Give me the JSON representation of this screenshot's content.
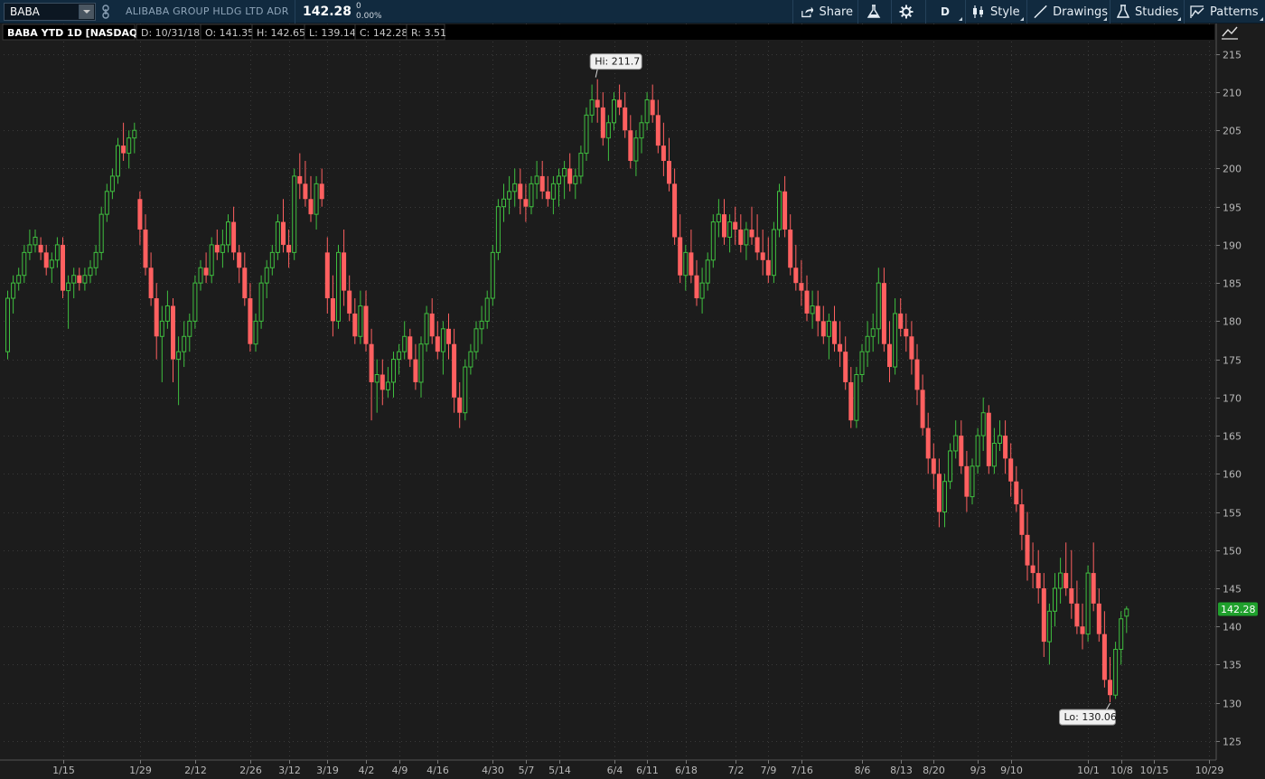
{
  "toolbar": {
    "symbol": "BABA",
    "company": "ALIBABA GROUP HLDG LTD ADR",
    "last": "142.28",
    "net_change": "0",
    "pct_change": "0.00%",
    "share_label": "Share",
    "aggregation_label": "D",
    "style_label": "Style",
    "drawings_label": "Drawings",
    "studies_label": "Studies",
    "patterns_label": "Patterns"
  },
  "chart_data": {
    "type": "candlestick",
    "title": "BABA YTD 1D [NASDAQ]",
    "header": {
      "date": "D: 10/31/18",
      "open": "O: 141.35",
      "high": "H: 142.65",
      "low": "L: 139.14",
      "close": "C: 142.28",
      "range": "R: 3.51"
    },
    "ylim": [
      122.5,
      219
    ],
    "y_ticks": [
      125,
      130,
      135,
      140,
      145,
      150,
      155,
      160,
      165,
      170,
      175,
      180,
      185,
      190,
      195,
      200,
      205,
      210,
      215
    ],
    "x_ticks": [
      "1/15",
      "1/29",
      "2/12",
      "2/26",
      "3/12",
      "3/19",
      "4/2",
      "4/9",
      "4/16",
      "4/30",
      "5/7",
      "5/14",
      "6/4",
      "6/11",
      "6/18",
      "7/2",
      "7/9",
      "7/16",
      "8/6",
      "8/13",
      "8/20",
      "9/3",
      "9/10",
      "10/1",
      "10/8",
      "10/15",
      "10/29"
    ],
    "x_tick_bar_index": [
      10,
      24,
      34,
      44,
      51,
      58,
      65,
      71,
      78,
      88,
      94,
      100,
      110,
      116,
      123,
      132,
      138,
      144,
      155,
      162,
      168,
      176,
      182,
      196,
      202,
      208,
      218
    ],
    "current_price_label": "142.28",
    "high_label": "Hi: 211.7",
    "low_label": "Lo: 130.06",
    "up_color": "#3fbf3f",
    "down_color": "#ff6060",
    "price_tag_color": "#1fa02c",
    "grid": true,
    "candles": [
      [
        176,
        184,
        175,
        183
      ],
      [
        183,
        186,
        181,
        185
      ],
      [
        185,
        187,
        184,
        186
      ],
      [
        186,
        190,
        185,
        189
      ],
      [
        189,
        192,
        188,
        190
      ],
      [
        190,
        192,
        189,
        191
      ],
      [
        190,
        191,
        188,
        189
      ],
      [
        189,
        190,
        186,
        187
      ],
      [
        187,
        189,
        185,
        188
      ],
      [
        188,
        191,
        187,
        190
      ],
      [
        190,
        191,
        183,
        184
      ],
      [
        184,
        186,
        179,
        185
      ],
      [
        185,
        187,
        183,
        186
      ],
      [
        186,
        187,
        184,
        185
      ],
      [
        185,
        187,
        184,
        186
      ],
      [
        186,
        188,
        185,
        187
      ],
      [
        187,
        190,
        186,
        189
      ],
      [
        189,
        195,
        188,
        194
      ],
      [
        194,
        198,
        193,
        197
      ],
      [
        197,
        200,
        196,
        199
      ],
      [
        199,
        204,
        198,
        203
      ],
      [
        203,
        206,
        201,
        202
      ],
      [
        202,
        205,
        200,
        204
      ],
      [
        204,
        206,
        202,
        205
      ],
      [
        196,
        197,
        190,
        192
      ],
      [
        192,
        194,
        186,
        187
      ],
      [
        187,
        189,
        182,
        183
      ],
      [
        183,
        185,
        175,
        178
      ],
      [
        178,
        182,
        172,
        180
      ],
      [
        180,
        184,
        179,
        182
      ],
      [
        182,
        183,
        172,
        175
      ],
      [
        175,
        178,
        169,
        176
      ],
      [
        176,
        180,
        174,
        178
      ],
      [
        178,
        181,
        176,
        180
      ],
      [
        180,
        186,
        179,
        185
      ],
      [
        185,
        188,
        184,
        187
      ],
      [
        187,
        189,
        185,
        186
      ],
      [
        186,
        191,
        185,
        190
      ],
      [
        190,
        192,
        188,
        189
      ],
      [
        189,
        192,
        187,
        190
      ],
      [
        190,
        194,
        189,
        193
      ],
      [
        193,
        195,
        188,
        189
      ],
      [
        189,
        190,
        185,
        187
      ],
      [
        187,
        189,
        182,
        183
      ],
      [
        183,
        185,
        176,
        177
      ],
      [
        177,
        181,
        176,
        180
      ],
      [
        180,
        186,
        179,
        185
      ],
      [
        185,
        188,
        183,
        187
      ],
      [
        187,
        190,
        186,
        189
      ],
      [
        189,
        194,
        188,
        193
      ],
      [
        193,
        196,
        189,
        190
      ],
      [
        190,
        192,
        187,
        189
      ],
      [
        189,
        200,
        188,
        199
      ],
      [
        199,
        202,
        196,
        198
      ],
      [
        198,
        201,
        195,
        196
      ],
      [
        196,
        199,
        193,
        194
      ],
      [
        194,
        199,
        192,
        198
      ],
      [
        198,
        200,
        195,
        196
      ],
      [
        189,
        191,
        181,
        183
      ],
      [
        183,
        186,
        178,
        180
      ],
      [
        180,
        190,
        179,
        189
      ],
      [
        189,
        192,
        182,
        184
      ],
      [
        184,
        186,
        180,
        181
      ],
      [
        181,
        183,
        177,
        178
      ],
      [
        178,
        184,
        177,
        182
      ],
      [
        182,
        184,
        176,
        177
      ],
      [
        177,
        179,
        167,
        172
      ],
      [
        172,
        175,
        168,
        173
      ],
      [
        173,
        175,
        169,
        171
      ],
      [
        171,
        174,
        170,
        172
      ],
      [
        172,
        176,
        170,
        175
      ],
      [
        175,
        177,
        173,
        176
      ],
      [
        176,
        180,
        175,
        178
      ],
      [
        178,
        179,
        174,
        175
      ],
      [
        175,
        177,
        171,
        172
      ],
      [
        172,
        178,
        170,
        177
      ],
      [
        177,
        182,
        176,
        181
      ],
      [
        181,
        183,
        177,
        178
      ],
      [
        178,
        180,
        175,
        176
      ],
      [
        176,
        180,
        173,
        179
      ],
      [
        179,
        181,
        175,
        177
      ],
      [
        177,
        179,
        168,
        170
      ],
      [
        170,
        172,
        166,
        168
      ],
      [
        168,
        175,
        167,
        174
      ],
      [
        174,
        177,
        173,
        176
      ],
      [
        176,
        180,
        175,
        179
      ],
      [
        179,
        182,
        177,
        180
      ],
      [
        180,
        184,
        179,
        183
      ],
      [
        183,
        190,
        182,
        189
      ],
      [
        189,
        196,
        188,
        195
      ],
      [
        195,
        198,
        193,
        196
      ],
      [
        196,
        199,
        194,
        197
      ],
      [
        197,
        200,
        195,
        198
      ],
      [
        198,
        200,
        194,
        196
      ],
      [
        196,
        198,
        193,
        195
      ],
      [
        195,
        199,
        194,
        198
      ],
      [
        198,
        201,
        196,
        199
      ],
      [
        199,
        201,
        196,
        197
      ],
      [
        197,
        199,
        195,
        196
      ],
      [
        196,
        199,
        194,
        198
      ],
      [
        198,
        200,
        195,
        199
      ],
      [
        199,
        201,
        196,
        200
      ],
      [
        200,
        202,
        197,
        198
      ],
      [
        198,
        200,
        196,
        199
      ],
      [
        199,
        203,
        198,
        202
      ],
      [
        202,
        208,
        201,
        207
      ],
      [
        207,
        211,
        206,
        209
      ],
      [
        209,
        211.7,
        206,
        208
      ],
      [
        208,
        210,
        203,
        204
      ],
      [
        204,
        207,
        201,
        206
      ],
      [
        206,
        210,
        205,
        209
      ],
      [
        209,
        211,
        207,
        208
      ],
      [
        208,
        210,
        204,
        205
      ],
      [
        205,
        207,
        200,
        201
      ],
      [
        201,
        205,
        199,
        204
      ],
      [
        204,
        207,
        202,
        206
      ],
      [
        206,
        210,
        205,
        209
      ],
      [
        209,
        211,
        206,
        207
      ],
      [
        207,
        209,
        202,
        203
      ],
      [
        203,
        206,
        199,
        201
      ],
      [
        201,
        204,
        197,
        198
      ],
      [
        198,
        200,
        190,
        191
      ],
      [
        191,
        194,
        185,
        186
      ],
      [
        186,
        190,
        184,
        189
      ],
      [
        189,
        192,
        185,
        186
      ],
      [
        186,
        188,
        182,
        183
      ],
      [
        183,
        187,
        181,
        185
      ],
      [
        185,
        189,
        184,
        188
      ],
      [
        188,
        194,
        187,
        193
      ],
      [
        193,
        196,
        191,
        194
      ],
      [
        194,
        196,
        190,
        191
      ],
      [
        191,
        194,
        189,
        193
      ],
      [
        193,
        195,
        190,
        192
      ],
      [
        192,
        194,
        189,
        190
      ],
      [
        190,
        193,
        188,
        192
      ],
      [
        192,
        195,
        190,
        191
      ],
      [
        191,
        194,
        188,
        189
      ],
      [
        189,
        192,
        186,
        188
      ],
      [
        188,
        191,
        185,
        186
      ],
      [
        186,
        193,
        185,
        192
      ],
      [
        192,
        198,
        191,
        197
      ],
      [
        197,
        199,
        191,
        192
      ],
      [
        192,
        194,
        186,
        187
      ],
      [
        187,
        190,
        184,
        185
      ],
      [
        185,
        188,
        182,
        184
      ],
      [
        184,
        186,
        180,
        181
      ],
      [
        181,
        184,
        179,
        182
      ],
      [
        182,
        184,
        178,
        180
      ],
      [
        180,
        182,
        177,
        178
      ],
      [
        178,
        181,
        175,
        180
      ],
      [
        180,
        182,
        176,
        177
      ],
      [
        177,
        180,
        174,
        176
      ],
      [
        176,
        178,
        171,
        172
      ],
      [
        172,
        174,
        166,
        167
      ],
      [
        167,
        174,
        166,
        173
      ],
      [
        173,
        177,
        172,
        176
      ],
      [
        176,
        180,
        174,
        178
      ],
      [
        178,
        181,
        176,
        179
      ],
      [
        179,
        187,
        177,
        185
      ],
      [
        185,
        187,
        176,
        177
      ],
      [
        177,
        180,
        172,
        174
      ],
      [
        174,
        183,
        173,
        181
      ],
      [
        181,
        183,
        178,
        179
      ],
      [
        179,
        181,
        176,
        178
      ],
      [
        178,
        180,
        173,
        175
      ],
      [
        175,
        177,
        169,
        171
      ],
      [
        171,
        173,
        165,
        166
      ],
      [
        166,
        168,
        160,
        162
      ],
      [
        162,
        164,
        158,
        160
      ],
      [
        160,
        162,
        153,
        155
      ],
      [
        155,
        160,
        153,
        159
      ],
      [
        159,
        164,
        158,
        163
      ],
      [
        163,
        167,
        162,
        165
      ],
      [
        165,
        167,
        160,
        161
      ],
      [
        161,
        163,
        155,
        157
      ],
      [
        157,
        162,
        156,
        161
      ],
      [
        161,
        166,
        160,
        165
      ],
      [
        165,
        170,
        163,
        168
      ],
      [
        168,
        169,
        160,
        161
      ],
      [
        161,
        166,
        160,
        164
      ],
      [
        164,
        167,
        163,
        165
      ],
      [
        165,
        167,
        160,
        162
      ],
      [
        162,
        164,
        157,
        159
      ],
      [
        159,
        161,
        155,
        156
      ],
      [
        156,
        158,
        150,
        152
      ],
      [
        152,
        155,
        146,
        148
      ],
      [
        148,
        151,
        145,
        147
      ],
      [
        147,
        150,
        143,
        145
      ],
      [
        145,
        147,
        136,
        138
      ],
      [
        138,
        143,
        135,
        142
      ],
      [
        142,
        147,
        140,
        145
      ],
      [
        145,
        149,
        143,
        147
      ],
      [
        147,
        151,
        144,
        145
      ],
      [
        145,
        150,
        141,
        143
      ],
      [
        143,
        146,
        139,
        140
      ],
      [
        140,
        143,
        137,
        139
      ],
      [
        139,
        148,
        138,
        147
      ],
      [
        147,
        151,
        142,
        143
      ],
      [
        143,
        145,
        138,
        139
      ],
      [
        139,
        142,
        132,
        133
      ],
      [
        133,
        136,
        130.06,
        131
      ],
      [
        131,
        138,
        130.5,
        137
      ],
      [
        137,
        142,
        135,
        141
      ],
      [
        141.35,
        142.65,
        139.14,
        142.28
      ]
    ]
  }
}
